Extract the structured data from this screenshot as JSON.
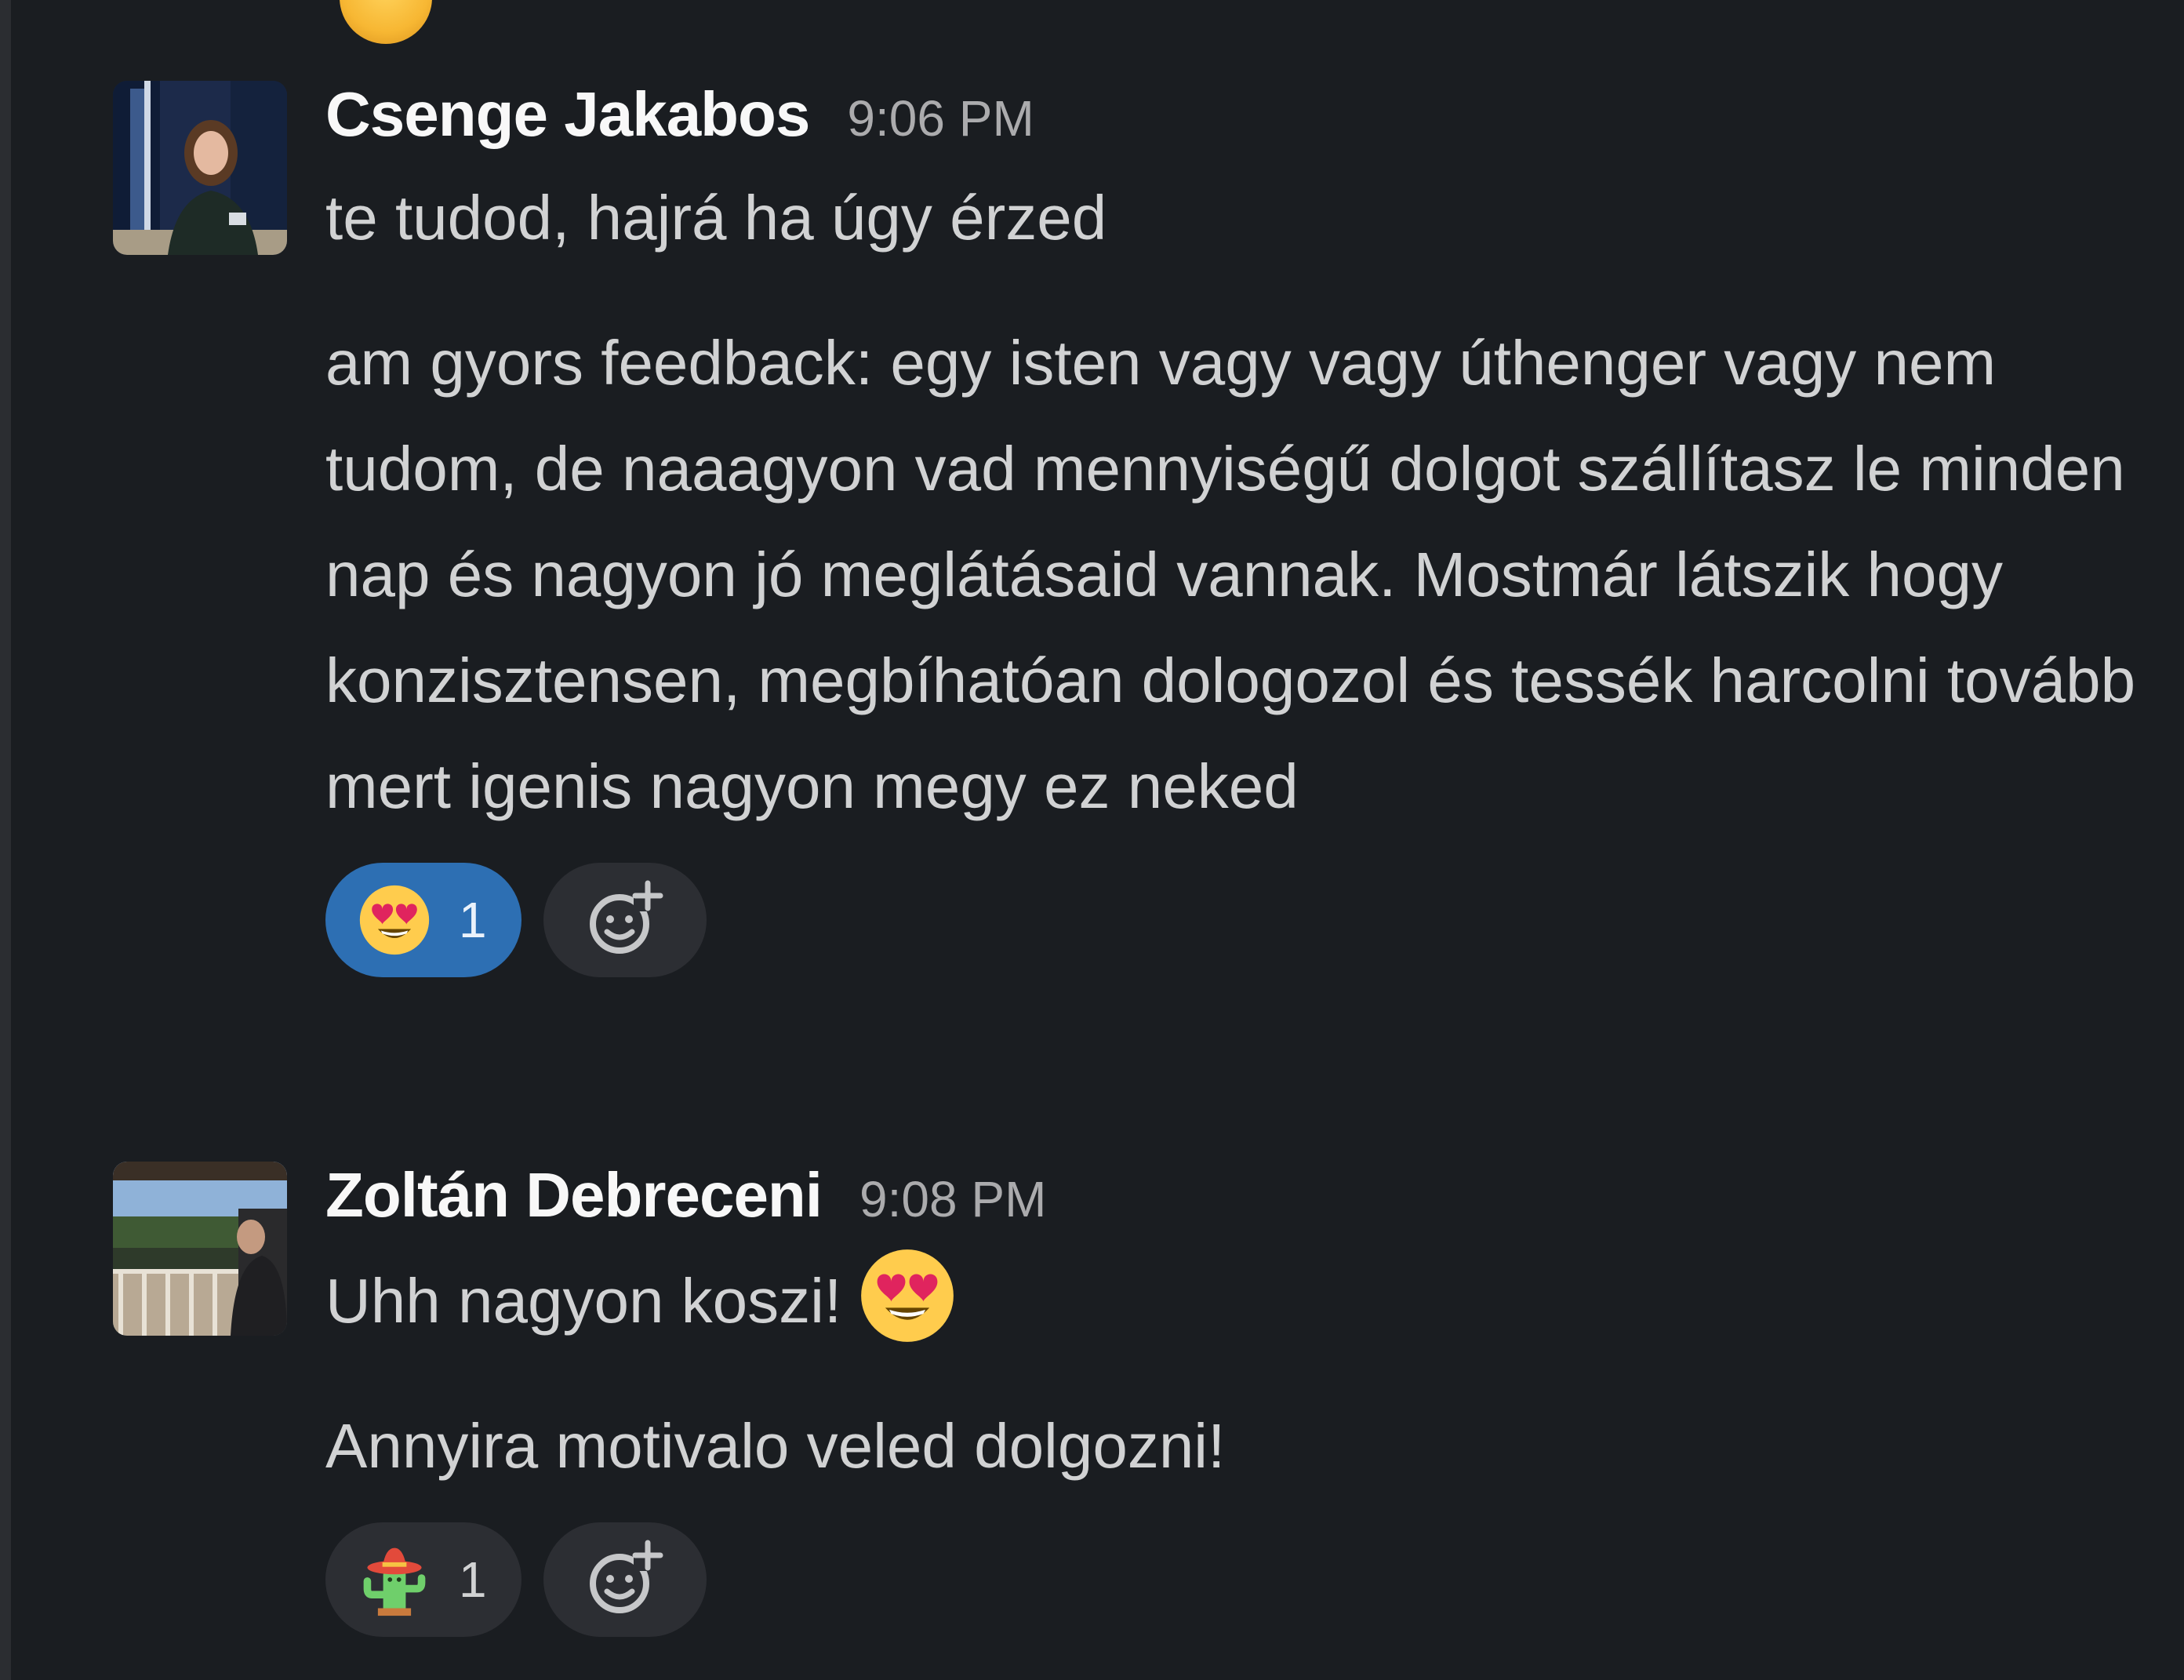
{
  "messages": [
    {
      "sender": "Csenge Jakabos",
      "time": "9:06 PM",
      "paragraphs": [
        "te tudod, hajrá ha úgy érzed",
        "am gyors feedback: egy isten vagy vagy úthenger vagy nem tudom, de naaagyon vad mennyiségű dolgot szállítasz le minden nap és nagyon jó meglátásaid vannak. Mostmár látszik hogy konzisztensen, megbíhatóan dologozol és tessék harcolni tovább mert igenis nagyon megy ez neked"
      ],
      "reactions": [
        {
          "emoji": "heart-eyes-emoji",
          "count": "1",
          "active": true
        }
      ],
      "avatar": "woman-portrait-photo"
    },
    {
      "sender": "Zoltán Debreceni",
      "time": "9:08 PM",
      "paragraphs": [
        "Uhh nagyon koszi!",
        "Annyira motivalo veled dolgozni!"
      ],
      "inline_emoji": "heart-eyes-emoji",
      "reactions": [
        {
          "emoji": "cactus-sombrero-emoji",
          "count": "1",
          "active": false
        }
      ],
      "avatar": "balcony-landscape-photo"
    }
  ],
  "colors": {
    "background": "#1a1d21",
    "text": "#d1d2d3",
    "sender": "#f8f8f8",
    "timestamp": "#ababad",
    "reaction_active": "#2d6fb3",
    "reaction_inactive": "#2c2e33"
  }
}
